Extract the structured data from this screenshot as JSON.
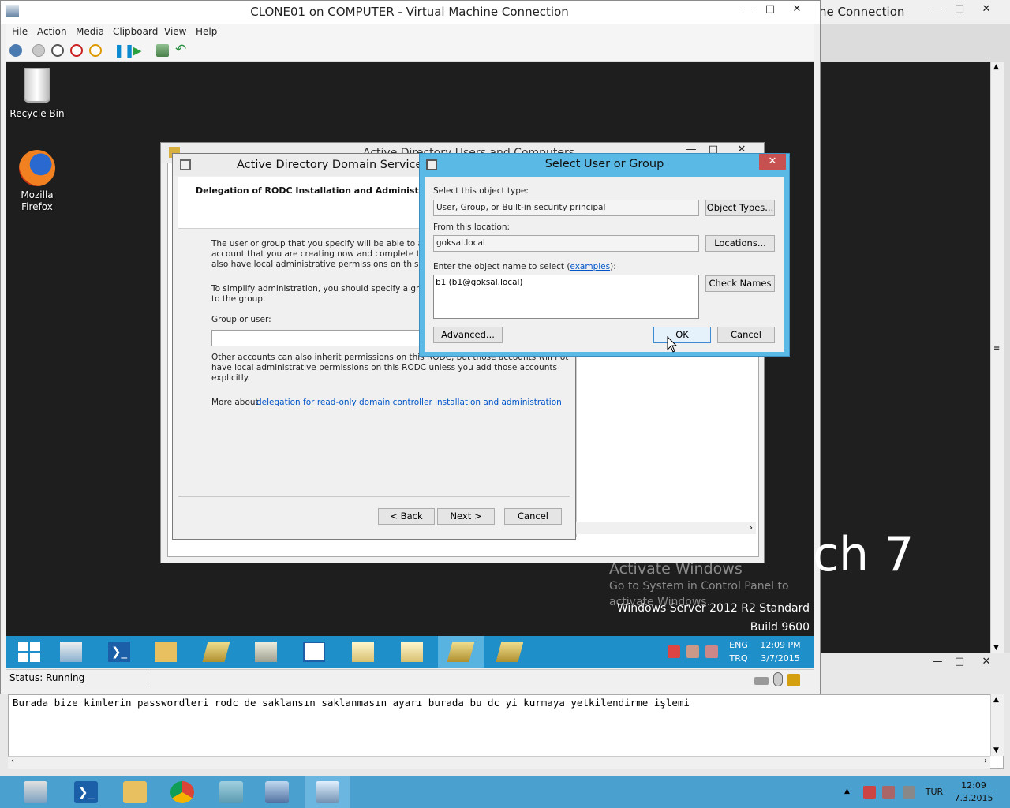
{
  "host": {
    "window_title": "he Connection",
    "editor_text": "Burada bize kimlerin passwordleri rodc de saklansın saklanmasın ayarı burada bu dc yi kurmaya yetkilendirme işlemi",
    "tray_lang": "TUR",
    "tray_time": "12:09",
    "tray_date": "7.3.2015"
  },
  "vm": {
    "title": "CLONE01 on COMPUTER - Virtual Machine Connection",
    "menu": [
      "File",
      "Action",
      "Media",
      "Clipboard",
      "View",
      "Help"
    ],
    "status": "Status: Running"
  },
  "guest": {
    "desktop_icons": [
      {
        "label": "Recycle Bin"
      },
      {
        "label": "Mozilla\nFirefox"
      }
    ],
    "big_text": "ch 7",
    "watermark_title": "Activate Windows",
    "watermark_line1": "Go to System in Control Panel to",
    "watermark_line2": "activate Windows.",
    "edition": "Windows Server 2012 R2 Standard",
    "build": "Build 9600",
    "tray_lang_1": "ENG",
    "tray_lang_2": "TRQ",
    "tray_time": "12:09 PM",
    "tray_date": "3/7/2015"
  },
  "aduc": {
    "title": "Active Directory Users and Computers"
  },
  "wizard": {
    "title": "Active Directory Domain Services In",
    "header": "Delegation of RODC Installation and Administratio",
    "para1_l1": "The user or group that you specify will be able to attach",
    "para1_l2": "account that you are creating now and complete the RO",
    "para1_l3": "also have local administrative permissions on this RODC",
    "para2_l1": "To simplify administration, you should specify a group an",
    "para2_l2": "to the group.",
    "group_label": "Group or user:",
    "para3_l1": "Other accounts can also inherit permissions on this RODC, but those accounts will not",
    "para3_l2": "have local administrative permissions on this RODC unless you add those accounts",
    "para3_l3": "explicitly.",
    "more_about": "More about",
    "more_link": "delegation for read-only domain controller installation and administration",
    "back": "< Back",
    "next": "Next >",
    "cancel": "Cancel"
  },
  "select_dialog": {
    "title": "Select User or Group",
    "object_type_label": "Select this object type:",
    "object_type_value": "User, Group, or Built-in security principal",
    "object_types_btn": "Object Types...",
    "location_label": "From this location:",
    "location_value": "goksal.local",
    "locations_btn": "Locations...",
    "enter_label": "Enter the object name to select (",
    "examples_link": "examples",
    "enter_label_end": "):",
    "object_name": "b1 (b1@goksal.local)",
    "check_names_btn": "Check Names",
    "advanced_btn": "Advanced...",
    "ok_btn": "OK",
    "cancel_btn": "Cancel"
  }
}
